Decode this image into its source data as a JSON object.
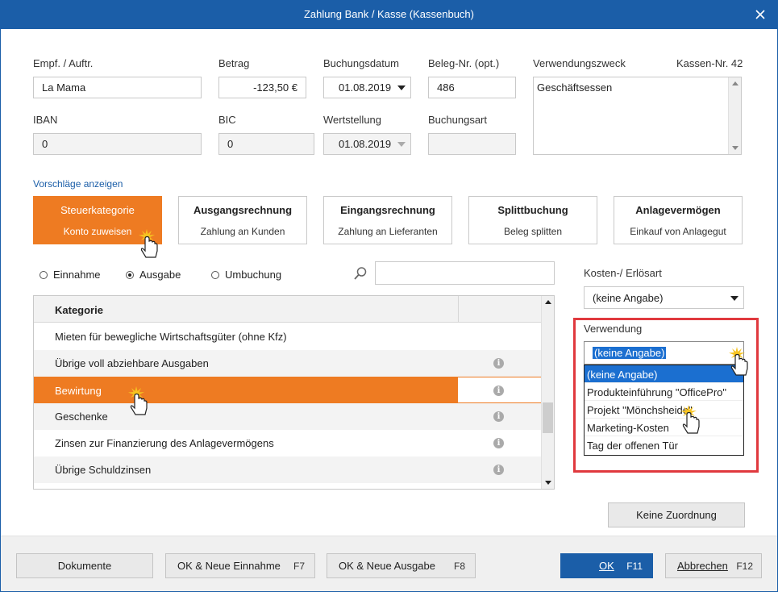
{
  "window": {
    "title": "Zahlung Bank / Kasse (Kassenbuch)"
  },
  "fields": {
    "empf_label": "Empf. / Auftr.",
    "empf_value": "La Mama",
    "betrag_label": "Betrag",
    "betrag_value": "-123,50 €",
    "buchungsdatum_label": "Buchungsdatum",
    "buchungsdatum_value": "01.08.2019",
    "beleg_label": "Beleg-Nr. (opt.)",
    "beleg_value": "486",
    "verwendungszweck_label": "Verwendungszweck",
    "verwendungszweck_value": "Geschäftsessen",
    "kassen_nr": "Kassen-Nr. 42",
    "iban_label": "IBAN",
    "iban_value": "0",
    "bic_label": "BIC",
    "bic_value": "0",
    "wertstellung_label": "Wertstellung",
    "wertstellung_value": "01.08.2019",
    "buchungsart_label": "Buchungsart",
    "buchungsart_value": ""
  },
  "suggestions_link": "Vorschläge anzeigen",
  "categories": [
    {
      "title": "Steuerkategorie",
      "sub": "Konto zuweisen"
    },
    {
      "title": "Ausgangsrechnung",
      "sub": "Zahlung an Kunden"
    },
    {
      "title": "Eingangsrechnung",
      "sub": "Zahlung an Lieferanten"
    },
    {
      "title": "Splittbuchung",
      "sub": "Beleg splitten"
    },
    {
      "title": "Anlagevermögen",
      "sub": "Einkauf von Anlagegut"
    }
  ],
  "radios": [
    {
      "label": "Einnahme",
      "selected": false
    },
    {
      "label": "Ausgabe",
      "selected": true
    },
    {
      "label": "Umbuchung",
      "selected": false
    }
  ],
  "search": {
    "value": ""
  },
  "table": {
    "header": "Kategorie",
    "rows": [
      {
        "label": "Mieten für bewegliche Wirtschaftsgüter (ohne Kfz)"
      },
      {
        "label": "Übrige voll abziehbare Ausgaben"
      },
      {
        "label": "Bewirtung"
      },
      {
        "label": "Geschenke"
      },
      {
        "label": "Zinsen zur Finanzierung des Anlagevermögens"
      },
      {
        "label": "Übrige Schuldzinsen"
      }
    ],
    "info_glyph": "i"
  },
  "kosten": {
    "label": "Kosten-/ Erlösart",
    "value": "(keine Angabe)"
  },
  "verwendung": {
    "label": "Verwendung",
    "value": "(keine Angabe)",
    "options": [
      "(keine Angabe)",
      "Produkteinführung \"OfficePro\"",
      "Projekt \"Mönchsheide\"",
      "Marketing-Kosten",
      "Tag der offenen Tür"
    ]
  },
  "keine_zuordnung": "Keine Zuordnung",
  "footer": {
    "dokumente": "Dokumente",
    "ok_einnahme": "OK & Neue Einnahme",
    "ok_einnahme_key": "F7",
    "ok_ausgabe": "OK & Neue Ausgabe",
    "ok_ausgabe_key": "F8",
    "ok": "OK",
    "ok_key": "F11",
    "abbrechen": "Abbrechen",
    "abbrechen_key": "F12"
  },
  "colors": {
    "titlebar": "#1b5ea8",
    "accent": "#ee7b22",
    "highlight": "#e0393e",
    "selection": "#1b6fd0"
  }
}
